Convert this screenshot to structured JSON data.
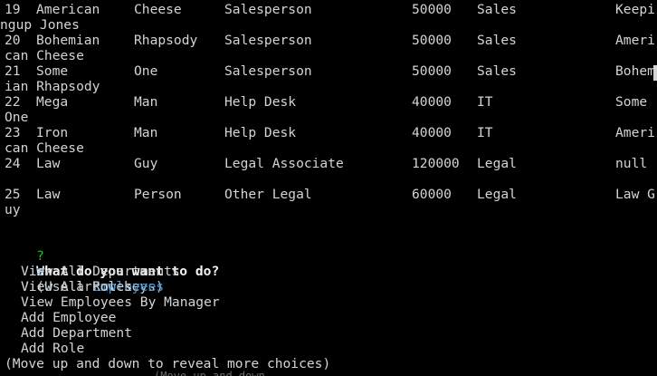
{
  "table_rows": [
    {
      "id": "19",
      "first_name": "American",
      "last_name": "Cheese",
      "role": "Salesperson",
      "salary": "50000",
      "department": "Sales",
      "manager": "Keepi",
      "wrap": "ngup Jones"
    },
    {
      "id": "20",
      "first_name": "Bohemian",
      "last_name": "Rhapsody",
      "role": "Salesperson",
      "salary": "50000",
      "department": "Sales",
      "manager": "Ameri",
      "wrap": "can Cheese"
    },
    {
      "id": "21",
      "first_name": "Some",
      "last_name": "One",
      "role": "Salesperson",
      "salary": "50000",
      "department": "Sales",
      "manager": "Bohem",
      "wrap": "ian Rhapsody"
    },
    {
      "id": "22",
      "first_name": "Mega",
      "last_name": "Man",
      "role": "Help Desk",
      "salary": "40000",
      "department": "IT",
      "manager": "Some",
      "wrap": "One"
    },
    {
      "id": "23",
      "first_name": "Iron",
      "last_name": "Man",
      "role": "Help Desk",
      "salary": "40000",
      "department": "IT",
      "manager": "Ameri",
      "wrap": "can Cheese"
    },
    {
      "id": "24",
      "first_name": "Law",
      "last_name": "Guy",
      "role": "Legal Associate",
      "salary": "120000",
      "department": "Legal",
      "manager": "null",
      "wrap": ""
    },
    {
      "id": "25",
      "first_name": "Law",
      "last_name": "Person",
      "role": "Other Legal",
      "salary": "60000",
      "department": "Legal",
      "manager": "Law G",
      "wrap": "uy"
    }
  ],
  "prompt": {
    "marker": "?",
    "question": "What do you want to do?",
    "hint": "(Use arrow keys)",
    "pointer": ">",
    "selected": "View All Employees",
    "choices": [
      "View All Departments",
      "View All Roles",
      "View Employees By Manager",
      "Add Employee",
      "Add Department",
      "Add Role"
    ],
    "footer": "(Move up and down to reveal more choices)"
  },
  "scroll_ghost": "(Move up and down",
  "colors": {
    "background": "#000000",
    "text": "#d4d4d4",
    "prompt_marker": "#16c60c",
    "selected": "#3a96dd"
  }
}
